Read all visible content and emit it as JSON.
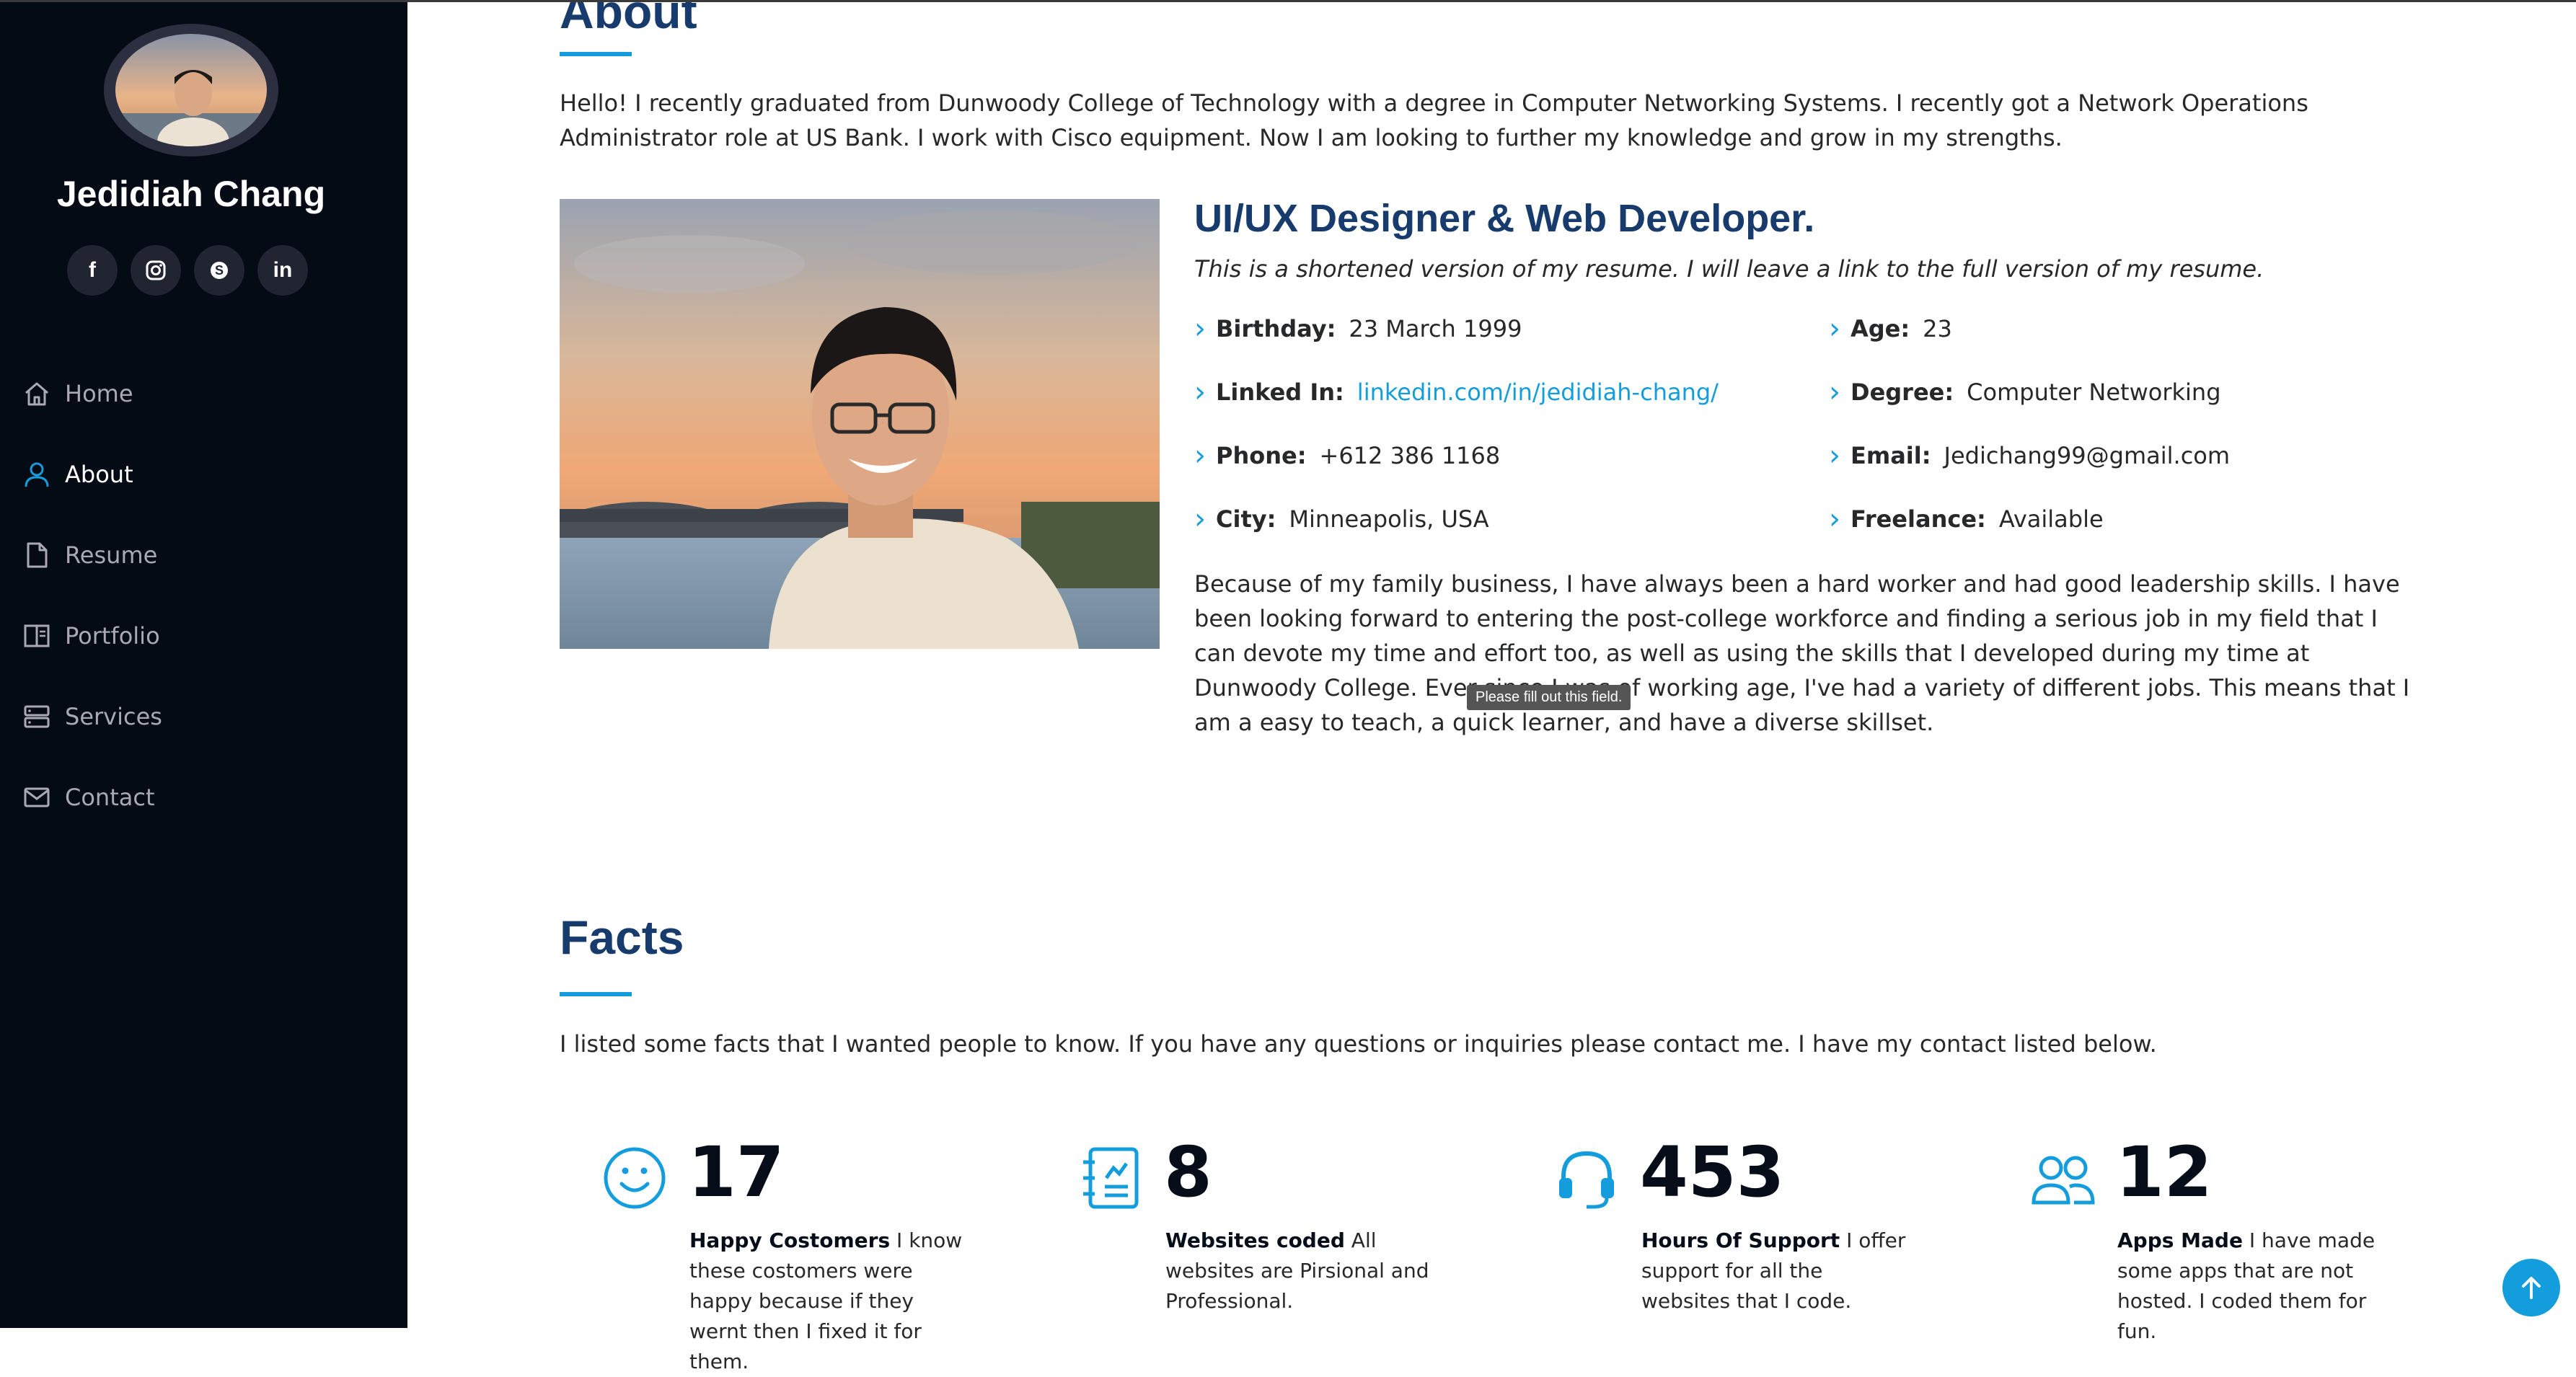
{
  "sidebar": {
    "name": "Jedidiah Chang",
    "socials": [
      {
        "icon": "facebook-icon",
        "glyph": "f"
      },
      {
        "icon": "instagram-icon"
      },
      {
        "icon": "skype-icon"
      },
      {
        "icon": "linkedin-icon",
        "glyph": "in"
      }
    ],
    "nav": [
      {
        "label": "Home",
        "icon": "home-icon",
        "active": false
      },
      {
        "label": "About",
        "icon": "person-icon",
        "active": true
      },
      {
        "label": "Resume",
        "icon": "file-icon",
        "active": false
      },
      {
        "label": "Portfolio",
        "icon": "book-icon",
        "active": false
      },
      {
        "label": "Services",
        "icon": "server-icon",
        "active": false
      },
      {
        "label": "Contact",
        "icon": "envelope-icon",
        "active": false
      }
    ]
  },
  "about": {
    "heading": "About",
    "intro": "Hello! I recently graduated from Dunwoody College of Technology with a degree in Computer Networking Systems. I recently got a Network Operations Administrator role at US Bank. I work with Cisco equipment. Now I am looking to further my knowledge and grow in my strengths.",
    "role": "UI/UX Designer & Web Developer.",
    "note": "This is a shortened version of my resume. I will leave a link to the full version of my resume.",
    "details_left": [
      {
        "label": "Birthday:",
        "value": "23 March 1999"
      },
      {
        "label": "Linked In:",
        "value": "linkedin.com/in/jedidiah-chang/",
        "link": true
      },
      {
        "label": "Phone:",
        "value": "+612 386 1168"
      },
      {
        "label": "City:",
        "value": "Minneapolis, USA"
      }
    ],
    "details_right": [
      {
        "label": "Age:",
        "value": "23"
      },
      {
        "label": "Degree:",
        "value": "Computer Networking"
      },
      {
        "label": "Email:",
        "value": "Jedichang99@gmail.com"
      },
      {
        "label": "Freelance:",
        "value": "Available"
      }
    ],
    "bio": "Because of my family business, I have always been a hard worker and had good leadership skills. I have been looking forward to entering the post-college workforce and finding a serious job in my field that I can devote my time and effort too, as well as using the skills that I developed during my time at Dunwoody College. Ever since I was of working age, I've had a variety of different jobs. This means that I am a easy to teach, a quick learner, and have a diverse skillset.",
    "tooltip": "Please fill out this field."
  },
  "facts": {
    "heading": "Facts",
    "intro": "I listed some facts that I wanted people to know. If you have any questions or inquiries please contact me. I have my contact listed below.",
    "items": [
      {
        "icon": "smile-icon",
        "number": "17",
        "title": "Happy Costomers",
        "text": "I know these costomers were happy because if they wernt then I fixed it for them."
      },
      {
        "icon": "journal-icon",
        "number": "8",
        "title": "Websites coded",
        "text": "All websites are Pirsional and Professional."
      },
      {
        "icon": "headset-icon",
        "number": "453",
        "title": "Hours Of Support",
        "text": "I offer support for all the websites that I code."
      },
      {
        "icon": "people-icon",
        "number": "12",
        "title": "Apps Made",
        "text": "I have made some apps that are not hosted. I coded them for fun."
      }
    ]
  },
  "colors": {
    "accent": "#149ddd",
    "heading": "#173b6c",
    "sidebar": "#040b14"
  },
  "back_to_top_icon": "arrow-up-icon"
}
